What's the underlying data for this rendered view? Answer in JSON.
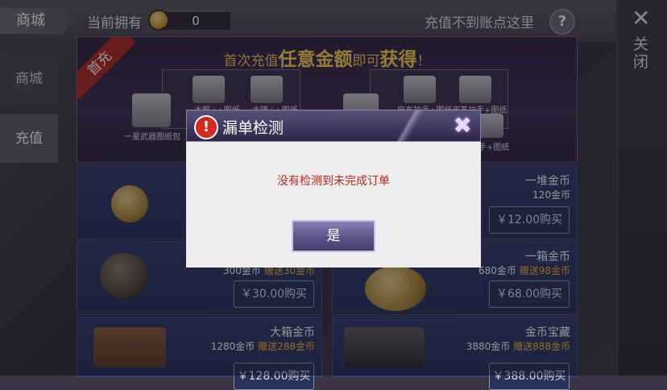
{
  "header": {
    "tab_label": "商城",
    "owned_label": "当前拥有",
    "owned_value": "0",
    "help_text": "充值不到账点这里",
    "help_icon": "?"
  },
  "close_panel": {
    "icon": "✕",
    "label": "关闭"
  },
  "sidebar": {
    "items": [
      {
        "label": "商城"
      },
      {
        "label": "充值"
      }
    ]
  },
  "banner": {
    "ribbon": "首充",
    "title_pre": "首次充值",
    "title_em1": "任意金额",
    "title_mid": "即可",
    "title_em2": "获得",
    "title_post": "！",
    "left_pack": "一星武器图纸包",
    "left_items": [
      "木棍++图纸",
      "木锤++图纸"
    ],
    "right_items": [
      "麻布护手+图纸",
      "皮革护手+图纸",
      "手+图纸"
    ]
  },
  "products": [
    {
      "name": "一堆金币",
      "sub": "120金币",
      "gift": "",
      "price": "￥12.00购买"
    },
    {
      "name": "",
      "sub": "300金币",
      "gift": "赠送30金币",
      "price": "￥30.00购买"
    },
    {
      "name": "一箱金币",
      "sub": "680金币",
      "gift": "赠送98金币",
      "price": "￥68.00购买"
    },
    {
      "name": "大箱金币",
      "sub": "1280金币",
      "gift": "赠送288金币",
      "price": "￥128.00购买"
    },
    {
      "name": "金币宝藏",
      "sub": "3880金币",
      "gift": "赠送888金币",
      "price": "￥388.00购买"
    }
  ],
  "dialog": {
    "title": "漏单检测",
    "warning_icon": "!",
    "close_icon": "✖",
    "message": "没有检测到未完成订单",
    "ok_label": "是"
  },
  "colors": {
    "accent_red": "#c0271b",
    "gift_gold": "#f2b631",
    "card_blue": "#2d3a68"
  }
}
